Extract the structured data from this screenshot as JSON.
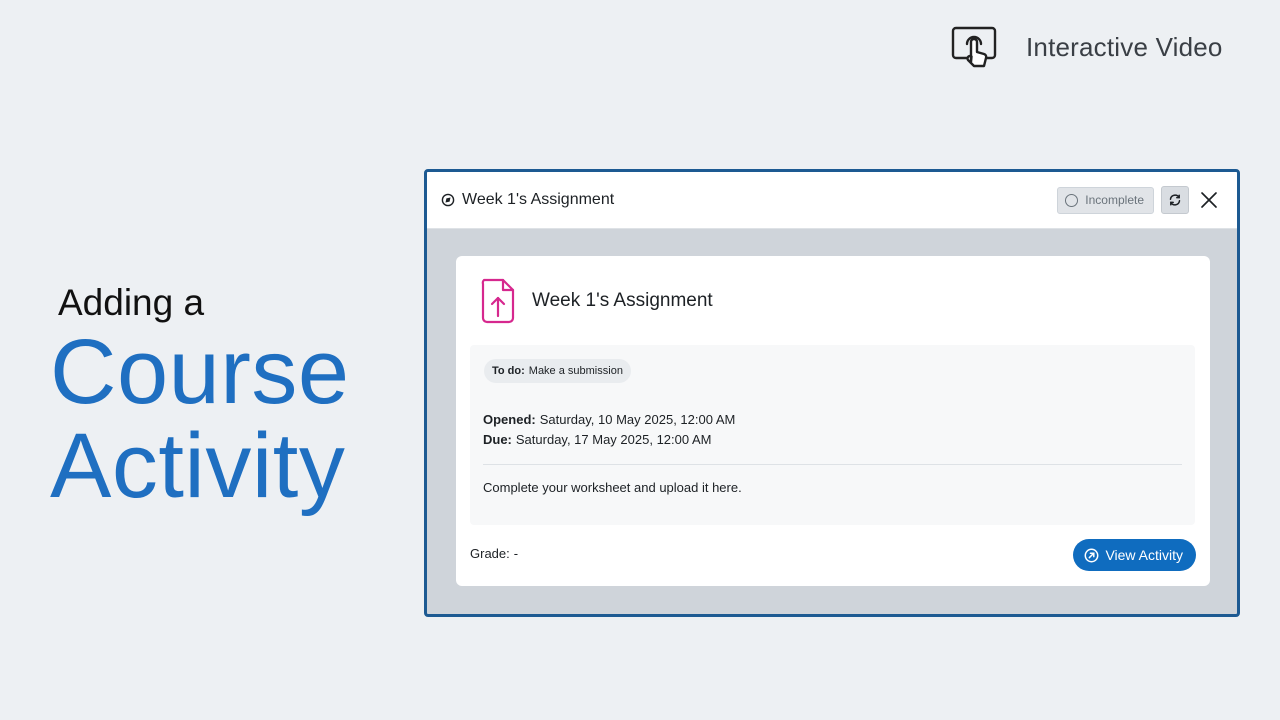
{
  "brand": {
    "label": "Interactive Video",
    "icon": "touch-screen-icon"
  },
  "heading": {
    "line1": "Adding a",
    "line2": "Course",
    "line3": "Activity",
    "accent_color": "#1f6fc1"
  },
  "modal": {
    "title": "Week 1's Assignment",
    "status": "Incomplete",
    "refresh_icon": "refresh-icon",
    "close_icon": "close-icon",
    "border_color": "#1d5a92"
  },
  "activity": {
    "title": "Week 1's Assignment",
    "icon": "file-upload-icon",
    "icon_color": "#d6288e",
    "todo_label": "To do:",
    "todo_value": "Make a submission",
    "opened_label": "Opened:",
    "opened_value": "Saturday, 10 May 2025, 12:00 AM",
    "due_label": "Due:",
    "due_value": "Saturday, 17 May 2025, 12:00 AM",
    "description": "Complete your worksheet and upload it here.",
    "grade_label": "Grade:",
    "grade_value": "-",
    "view_button": "View Activity",
    "button_color": "#0f6cbf"
  }
}
